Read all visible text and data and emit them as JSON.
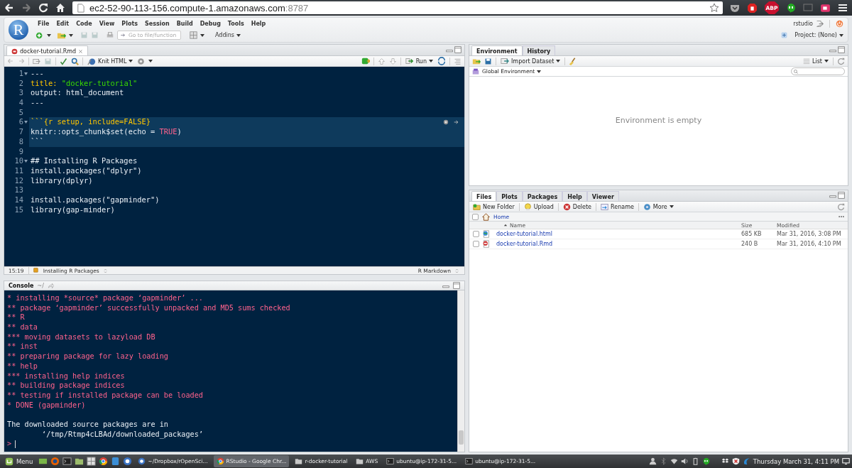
{
  "browser": {
    "url_host": "ec2-52-90-113-156.compute-1.amazonaws.com",
    "url_port": ":8787",
    "abp_badge": "ABP"
  },
  "app": {
    "logo": "R",
    "menu": [
      "File",
      "Edit",
      "Code",
      "View",
      "Plots",
      "Session",
      "Build",
      "Debug",
      "Tools",
      "Help"
    ],
    "user": "rstudio",
    "goto_placeholder": "Go to file/function",
    "addins": "Addins",
    "project": "Project: (None)"
  },
  "editor": {
    "tab": {
      "label": "docker-tutorial.Rmd",
      "selected": true
    },
    "knit": "Knit HTML",
    "run": "Run",
    "lines": [
      {
        "number": "1",
        "fold": true,
        "chunk": false,
        "tokens": [
          {
            "text": "---",
            "kind": "plain"
          }
        ]
      },
      {
        "number": "2",
        "fold": false,
        "chunk": false,
        "tokens": [
          {
            "text": "title: ",
            "kind": "key"
          },
          {
            "text": "\"docker-tutorial\"",
            "kind": "string"
          }
        ]
      },
      {
        "number": "3",
        "fold": false,
        "chunk": false,
        "tokens": [
          {
            "text": "output: html_document",
            "kind": "plain"
          }
        ]
      },
      {
        "number": "4",
        "fold": false,
        "chunk": false,
        "tokens": [
          {
            "text": "---",
            "kind": "plain"
          }
        ]
      },
      {
        "number": "5",
        "fold": false,
        "chunk": false
      },
      {
        "number": "6",
        "fold": true,
        "chunk": true,
        "tokens": [
          {
            "text": "```{r setup, include=FALSE}",
            "kind": "key"
          }
        ]
      },
      {
        "number": "7",
        "fold": false,
        "chunk": true,
        "tokens": [
          {
            "text": "knitr::opts_chunk$set(echo = ",
            "kind": "plain"
          },
          {
            "text": "TRUE",
            "kind": "constant"
          },
          {
            "text": ")",
            "kind": "plain"
          }
        ]
      },
      {
        "number": "8",
        "fold": false,
        "chunk": true,
        "tokens": [
          {
            "text": "```",
            "kind": "plain"
          }
        ]
      },
      {
        "number": "9",
        "fold": false,
        "chunk": false
      },
      {
        "number": "10",
        "fold": true,
        "chunk": false,
        "tokens": [
          {
            "text": "## Installing R Packages",
            "kind": "plain"
          }
        ]
      },
      {
        "number": "11",
        "fold": false,
        "chunk": false,
        "tokens": [
          {
            "text": "install.packages(\"dplyr\")",
            "kind": "plain"
          }
        ]
      },
      {
        "number": "12",
        "fold": false,
        "chunk": false,
        "tokens": [
          {
            "text": "library(dplyr)",
            "kind": "plain"
          }
        ]
      },
      {
        "number": "13",
        "fold": false,
        "chunk": false
      },
      {
        "number": "14",
        "fold": false,
        "chunk": false,
        "tokens": [
          {
            "text": "install.packages(\"gapminder\")",
            "kind": "plain"
          }
        ]
      },
      {
        "number": "15",
        "fold": false,
        "chunk": false,
        "tokens": [
          {
            "text": "library(gap-minder)",
            "kind": "plain"
          }
        ]
      }
    ],
    "status": {
      "position": "15:19",
      "section": "Installing R Packages",
      "mode": "R Markdown"
    }
  },
  "console": {
    "tab": {
      "label": "Console",
      "selected": true
    },
    "path": "~/",
    "lines": [
      {
        "text": "* installing *source* package ‘gapminder’ ...",
        "kind": "message"
      },
      {
        "text": "** package ‘gapminder’ successfully unpacked and MD5 sums checked",
        "kind": "message"
      },
      {
        "text": "** R",
        "kind": "message"
      },
      {
        "text": "** data",
        "kind": "message"
      },
      {
        "text": "*** moving datasets to lazyload DB",
        "kind": "message"
      },
      {
        "text": "** inst",
        "kind": "message"
      },
      {
        "text": "** preparing package for lazy loading",
        "kind": "message"
      },
      {
        "text": "** help",
        "kind": "message"
      },
      {
        "text": "*** installing help indices",
        "kind": "message"
      },
      {
        "text": "** building package indices",
        "kind": "message"
      },
      {
        "text": "** testing if installed package can be loaded",
        "kind": "message"
      },
      {
        "text": "* DONE (gapminder)",
        "kind": "message"
      },
      {
        "kind": "blank"
      },
      {
        "text": "The downloaded source packages are in",
        "kind": "output"
      },
      {
        "text": "\t‘/tmp/Rtmp4cLBAd/downloaded_packages’",
        "kind": "output"
      }
    ],
    "prompt": ">"
  },
  "environment": {
    "tabs": [
      {
        "label": "Environment",
        "selected": true
      },
      {
        "label": "History",
        "selected": false
      }
    ],
    "import": "Import Dataset",
    "view": "List",
    "scope": "Global Environment",
    "empty": "Environment is empty"
  },
  "files": {
    "tabs": [
      {
        "label": "Files",
        "selected": true
      },
      {
        "label": "Plots",
        "selected": false
      },
      {
        "label": "Packages",
        "selected": false
      },
      {
        "label": "Help",
        "selected": false
      },
      {
        "label": "Viewer",
        "selected": false
      }
    ],
    "actions": [
      {
        "label": "New Folder",
        "kind": "folder"
      },
      {
        "label": "Upload",
        "kind": "upload"
      },
      {
        "label": "Delete",
        "kind": "delete"
      },
      {
        "label": "Rename",
        "kind": "rename"
      },
      {
        "label": "More",
        "kind": "more"
      }
    ],
    "path_checked": false,
    "path": "Home",
    "columns": [
      "Name",
      "Size",
      "Modified"
    ],
    "rows": [
      {
        "name": "docker-tutorial.html",
        "kind": "html",
        "size": "685 KB",
        "modified": "Mar 31, 2016, 3:08 PM",
        "checked": false
      },
      {
        "name": "docker-tutorial.Rmd",
        "kind": "rmd",
        "size": "240 B",
        "modified": "Mar 31, 2016, 4:10 PM",
        "checked": false
      }
    ]
  },
  "taskbar": {
    "menu": "Menu",
    "windows": [
      {
        "label": "~/Dropbox/rOpenSci...",
        "kind": "r",
        "selected": false
      },
      {
        "label": "RStudio - Google Chr...",
        "kind": "chrome",
        "selected": true
      },
      {
        "label": "r-docker-tutorial",
        "kind": "folder",
        "selected": false
      },
      {
        "label": "AWS",
        "kind": "folder",
        "selected": false
      },
      {
        "label": "ubuntu@ip-172-31-5...",
        "kind": "terminal",
        "selected": false
      },
      {
        "label": "ubuntu@ip-172-31-5...",
        "kind": "terminal",
        "selected": false
      }
    ],
    "clock": "Thursday March 31, 4:11 PM"
  }
}
